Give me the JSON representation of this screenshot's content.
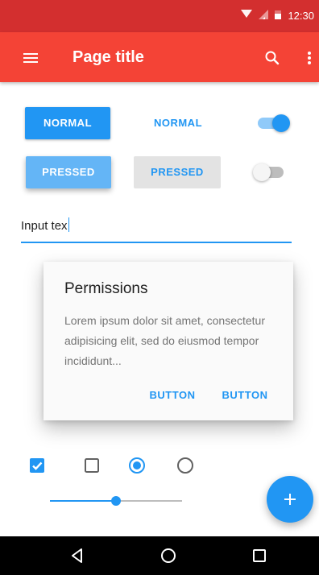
{
  "status_bar": {
    "time": "12:30",
    "icons": [
      "wifi-icon",
      "signal-icon",
      "battery-icon"
    ],
    "color": "#d32f2f"
  },
  "app_bar": {
    "title": "Page title",
    "color": "#f44336",
    "icons": [
      "menu-icon",
      "search-icon",
      "more-vert-icon"
    ]
  },
  "buttons": {
    "raised_normal": "NORMAL",
    "flat_normal": "NORMAL",
    "raised_pressed": "PRESSED",
    "flat_pressed": "PRESSED"
  },
  "switches": {
    "first": {
      "on": true
    },
    "second": {
      "on": false
    }
  },
  "text_field": {
    "value": "Input tex"
  },
  "dialog": {
    "title": "Permissions",
    "body": "Lorem ipsum dolor sit amet, consectetur adipisicing elit, sed do eiusmod tempor incididunt...",
    "button_1": "BUTTON",
    "button_2": "BUTTON"
  },
  "controls": {
    "checkbox_1_checked": true,
    "checkbox_2_checked": false,
    "radio_1_selected": true,
    "radio_2_selected": false
  },
  "slider": {
    "value": 0.5
  },
  "fab": {
    "icon": "plus-icon"
  },
  "nav_bar": {
    "icons": [
      "back-icon",
      "home-icon",
      "recents-icon"
    ]
  },
  "colors": {
    "accent": "#2196f3",
    "primary": "#f44336",
    "primary_dark": "#d32f2f"
  }
}
